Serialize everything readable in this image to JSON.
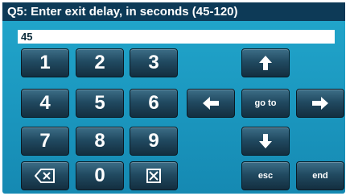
{
  "prompt": {
    "title": "Q5: Enter exit delay, in seconds (45-120)"
  },
  "entry": {
    "value": "45"
  },
  "keypad": {
    "k1": "1",
    "k2": "2",
    "k3": "3",
    "k4": "4",
    "k5": "5",
    "k6": "6",
    "k7": "7",
    "k8": "8",
    "k9": "9",
    "k0": "0"
  },
  "nav": {
    "goto": "go to",
    "esc": "esc",
    "end": "end"
  },
  "icons": {
    "backspace": "backspace-icon",
    "clear": "clear-icon",
    "up": "arrow-up-icon",
    "down": "arrow-down-icon",
    "left": "arrow-left-icon",
    "right": "arrow-right-icon"
  }
}
